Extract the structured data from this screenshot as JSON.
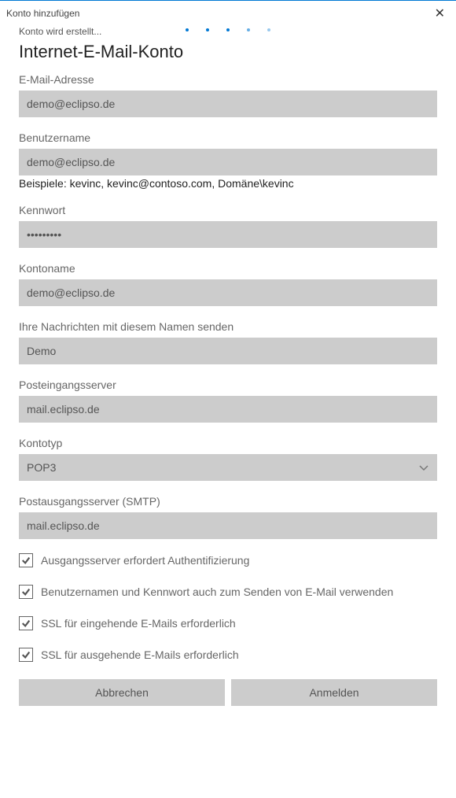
{
  "titlebar": {
    "title": "Konto hinzufügen"
  },
  "status": "Konto wird erstellt...",
  "heading": "Internet-E-Mail-Konto",
  "fields": {
    "email": {
      "label": "E-Mail-Adresse",
      "value": "demo@eclipso.de"
    },
    "user": {
      "label": "Benutzername",
      "value": "demo@eclipso.de",
      "hint": "Beispiele: kevinc, kevinc@contoso.com, Domäne\\kevinc"
    },
    "pass": {
      "label": "Kennwort",
      "value": "•••••••••"
    },
    "account": {
      "label": "Kontoname",
      "value": "demo@eclipso.de"
    },
    "sender": {
      "label": "Ihre Nachrichten mit diesem Namen senden",
      "value": "Demo"
    },
    "incoming": {
      "label": "Posteingangsserver",
      "value": "mail.eclipso.de"
    },
    "type": {
      "label": "Kontotyp",
      "value": "POP3"
    },
    "outgoing": {
      "label": "Postausgangsserver (SMTP)",
      "value": "mail.eclipso.de"
    }
  },
  "checkboxes": {
    "auth": {
      "label": "Ausgangsserver erfordert Authentifizierung",
      "checked": true
    },
    "same": {
      "label": "Benutzernamen und Kennwort auch zum Senden von E-Mail verwenden",
      "checked": true
    },
    "sslin": {
      "label": "SSL für eingehende E-Mails erforderlich",
      "checked": true
    },
    "sslout": {
      "label": "SSL für ausgehende E-Mails erforderlich",
      "checked": true
    }
  },
  "buttons": {
    "cancel": "Abbrechen",
    "signin": "Anmelden"
  }
}
